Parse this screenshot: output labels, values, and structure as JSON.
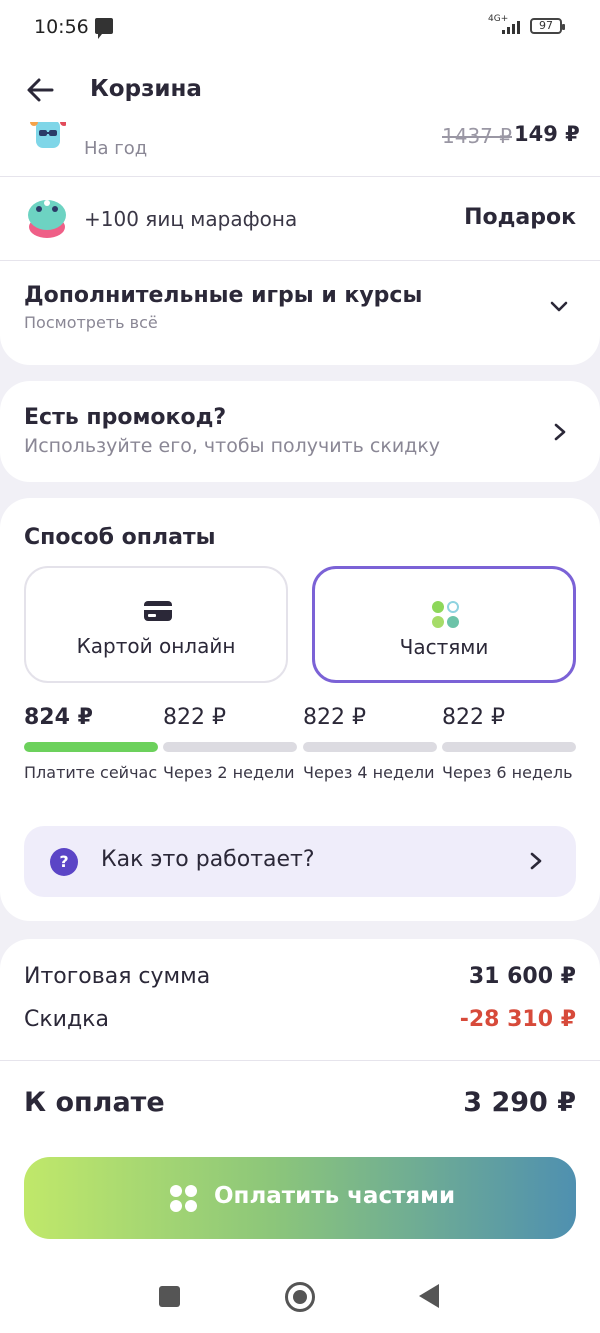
{
  "status_bar": {
    "time": "10:56",
    "network": "4G+",
    "battery": "97"
  },
  "header": {
    "title": "Корзина"
  },
  "subscription": {
    "period": "На год",
    "old_price": "1437 ₽",
    "price": "149 ₽"
  },
  "gift": {
    "label": "+100 яиц марафона",
    "value": "Подарок"
  },
  "more_games": {
    "title": "Дополнительные игры и курсы",
    "subtitle": "Посмотреть всё"
  },
  "promo": {
    "title": "Есть промокод?",
    "subtitle": "Используйте его, чтобы получить скидку"
  },
  "payment": {
    "title": "Способ оплаты",
    "methods": [
      {
        "label": "Картой онлайн",
        "selected": false
      },
      {
        "label": "Частями",
        "selected": true
      }
    ],
    "installments": [
      {
        "amount": "824 ₽",
        "label": "Платите сейчас",
        "paid_now": true
      },
      {
        "amount": "822 ₽",
        "label": "Через 2 недели",
        "paid_now": false
      },
      {
        "amount": "822 ₽",
        "label": "Через 4 недели",
        "paid_now": false
      },
      {
        "amount": "822 ₽",
        "label": "Через 6 недель",
        "paid_now": false
      }
    ],
    "how_it_works": "Как это работает?"
  },
  "summary": {
    "total_label": "Итоговая сумма",
    "total_value": "31 600 ₽",
    "discount_label": "Скидка",
    "discount_value": "-28 310 ₽",
    "pay_label": "К оплате",
    "pay_value": "3 290 ₽"
  },
  "pay_button": {
    "label": "Оплатить частями"
  },
  "colors": {
    "accent_purple": "#7b62d6",
    "progress_green": "#6cd15c",
    "discount_red": "#d74a3a",
    "button_gradient": [
      "#c0e86a",
      "#4f90b0"
    ]
  }
}
